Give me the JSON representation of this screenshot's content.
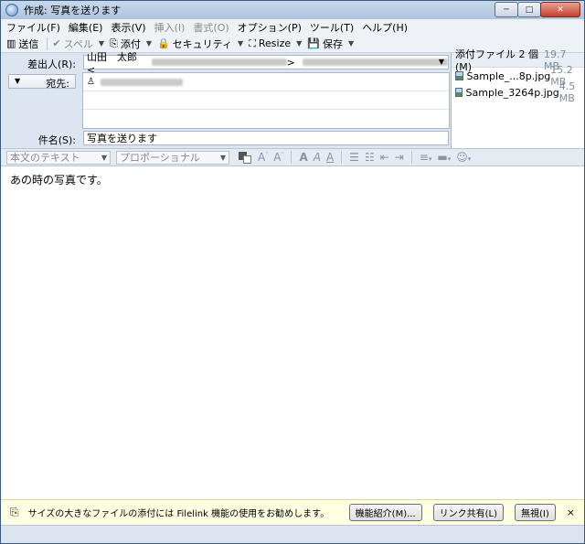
{
  "window": {
    "title": "作成: 写真を送ります",
    "minimize": "─",
    "maximize": "□",
    "close": "✕"
  },
  "menu": [
    {
      "label": "ファイル(F)",
      "disabled": false
    },
    {
      "label": "編集(E)",
      "disabled": false
    },
    {
      "label": "表示(V)",
      "disabled": false
    },
    {
      "label": "挿入(I)",
      "disabled": true
    },
    {
      "label": "書式(O)",
      "disabled": true
    },
    {
      "label": "オプション(P)",
      "disabled": false
    },
    {
      "label": "ツール(T)",
      "disabled": false
    },
    {
      "label": "ヘルプ(H)",
      "disabled": false
    }
  ],
  "toolbar": {
    "send": "送信",
    "spell": "スペル",
    "attach": "添付",
    "security": "セキュリティ",
    "resize": "Resize",
    "save": "保存"
  },
  "header": {
    "from_label": "差出人(R):",
    "from_name": "山田　太郎 <",
    "from_bracket": ">",
    "to_label": "宛先:",
    "subject_label": "件名(S):",
    "subject_value": "写真を送ります"
  },
  "attachments": {
    "header": "添付ファイル 2 個(M)",
    "total_size": "19.7 MB",
    "items": [
      {
        "name": "Sample_...8p.jpg",
        "size": "15.2 MB"
      },
      {
        "name": "Sample_3264p.jpg",
        "size": "4.5 MB"
      }
    ]
  },
  "format": {
    "paragraph": "本文のテキスト",
    "font": "プロポーショナル"
  },
  "body": {
    "text": "あの時の写真です。"
  },
  "notification": {
    "message": "サイズの大きなファイルの添付には Filelink 機能の使用をお勧めします。",
    "feature_button": "機能紹介(M)...",
    "link_button": "リンク共有(L)",
    "ignore_button": "無視(I)",
    "close": "×"
  }
}
